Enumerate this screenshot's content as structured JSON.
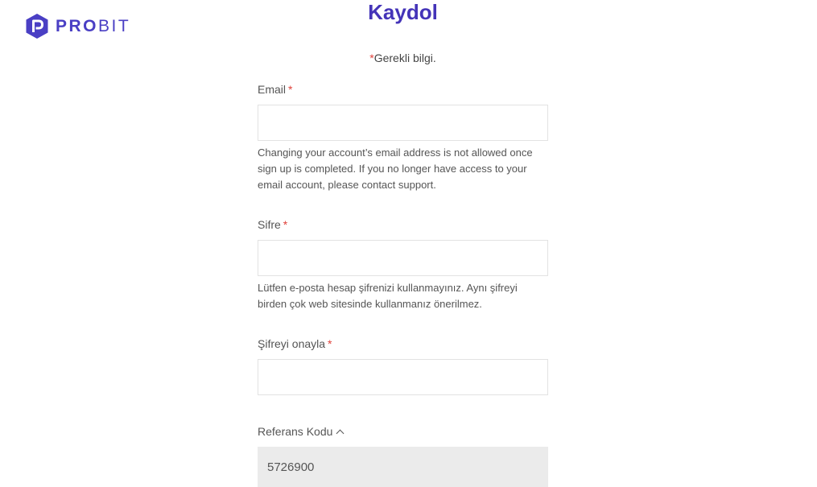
{
  "brand": {
    "name_part1": "PRO",
    "name_part2": "BIT",
    "logo_icon": "probit-hexagon-logo-icon",
    "color": "#4a3fc4"
  },
  "page": {
    "title": "Kaydol",
    "required_asterisk": "*",
    "required_note": "Gerekli bilgi."
  },
  "fields": {
    "email": {
      "label": "Email",
      "asterisk": "*",
      "value": "",
      "help": "Changing your account’s email address is not allowed once sign up is completed. If you no longer have access to your email account, please contact support."
    },
    "password": {
      "label": "Sifre",
      "asterisk": "*",
      "value": "",
      "help": "Lütfen e-posta hesap şifrenizi kullanmayınız. Aynı şifreyi birden çok web sitesinde kullanmanız önerilmez."
    },
    "confirm_password": {
      "label": "Şifreyi onayla",
      "asterisk": "*",
      "value": ""
    },
    "referral": {
      "label": "Referans Kodu",
      "toggle_icon": "chevron-up-icon",
      "value": "5726900"
    }
  },
  "colors": {
    "accent": "#4434b8",
    "required": "#e0413a",
    "referral_bg": "#ebebeb"
  }
}
